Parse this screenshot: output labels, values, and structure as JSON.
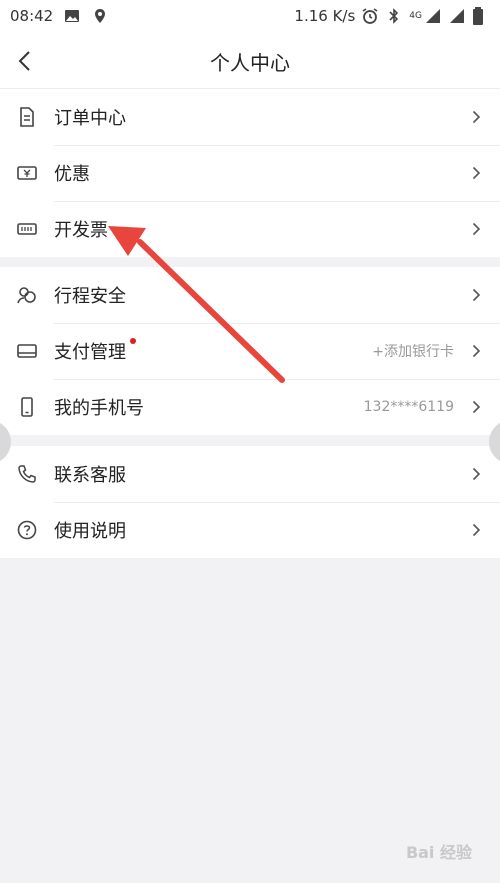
{
  "status_bar": {
    "time": "08:42",
    "speed": "1.16 K/s",
    "network": "4G",
    "icons": [
      "image-icon",
      "location-icon",
      "alarm-icon",
      "bluetooth-icon",
      "signal-icon",
      "battery-icon"
    ]
  },
  "header": {
    "title": "个人中心",
    "back_icon": "chevron-left-icon"
  },
  "groups": [
    {
      "items": [
        {
          "label": "订单中心",
          "icon": "document-icon",
          "value": ""
        },
        {
          "label": "优惠",
          "icon": "coupon-icon",
          "value": ""
        },
        {
          "label": "开发票",
          "icon": "invoice-icon",
          "value": ""
        }
      ]
    },
    {
      "items": [
        {
          "label": "行程安全",
          "icon": "shield-people-icon",
          "value": ""
        },
        {
          "label": "支付管理",
          "icon": "card-icon",
          "value": "+添加银行卡",
          "badge": "red-dot"
        },
        {
          "label": "我的手机号",
          "icon": "phone-icon",
          "value": "132****6119"
        }
      ]
    },
    {
      "items": [
        {
          "label": "联系客服",
          "icon": "phone-call-icon",
          "value": ""
        },
        {
          "label": "使用说明",
          "icon": "question-icon",
          "value": ""
        }
      ]
    }
  ],
  "colors": {
    "accent_red": "#e0201b",
    "arrow_red": "#e8453c",
    "background": "#f2f2f4"
  },
  "watermark": "Bai 经验"
}
